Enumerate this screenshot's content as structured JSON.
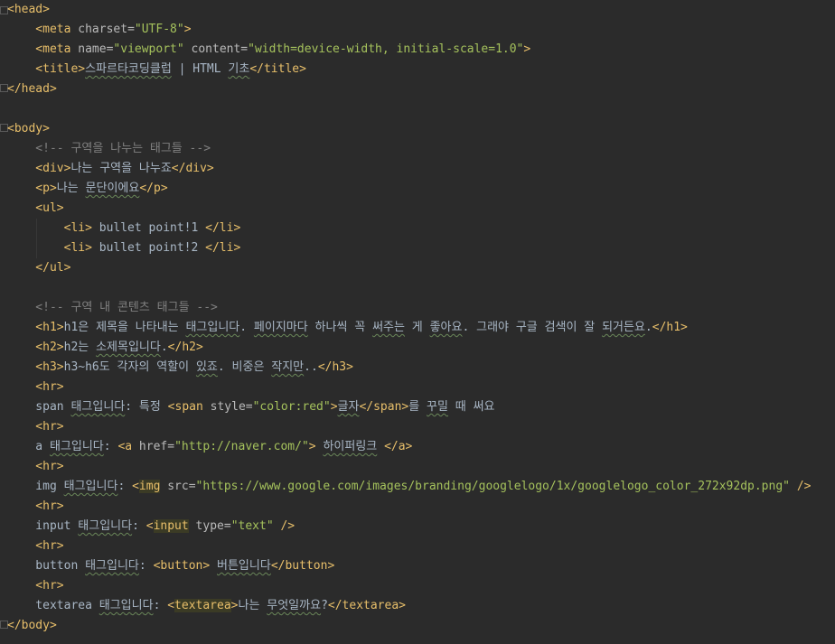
{
  "editor": {
    "lines": [
      [
        {
          "t": "tag",
          "v": "<head>"
        }
      ],
      [
        {
          "t": "tag",
          "v": "    <meta "
        },
        {
          "t": "attr",
          "v": "charset="
        },
        {
          "t": "val",
          "v": "\"UTF-8\""
        },
        {
          "t": "tag",
          "v": ">"
        }
      ],
      [
        {
          "t": "tag",
          "v": "    <meta "
        },
        {
          "t": "attr",
          "v": "name="
        },
        {
          "t": "val",
          "v": "\"viewport\" "
        },
        {
          "t": "attr",
          "v": "content="
        },
        {
          "t": "val",
          "v": "\"width=device-width, initial-scale=1.0\""
        },
        {
          "t": "tag",
          "v": ">"
        }
      ],
      [
        {
          "t": "tag",
          "v": "    <title>"
        },
        {
          "t": "sp",
          "v": "스파르타코딩클럽"
        },
        {
          "t": "txt",
          "v": " | HTML "
        },
        {
          "t": "sp",
          "v": "기초"
        },
        {
          "t": "tag",
          "v": "</title>"
        }
      ],
      [
        {
          "t": "tag",
          "v": "</head>"
        }
      ],
      [
        {
          "t": "txt",
          "v": ""
        }
      ],
      [
        {
          "t": "tag",
          "v": "<body>"
        }
      ],
      [
        {
          "t": "cm",
          "v": "    <!-- 구역을 나누는 태그들 -->"
        }
      ],
      [
        {
          "t": "tag",
          "v": "    <div>"
        },
        {
          "t": "txt",
          "v": "나는 구역을 나누죠"
        },
        {
          "t": "tag",
          "v": "</div>"
        }
      ],
      [
        {
          "t": "tag",
          "v": "    <p>"
        },
        {
          "t": "txt",
          "v": "나는 "
        },
        {
          "t": "sp",
          "v": "문단이에요"
        },
        {
          "t": "tag",
          "v": "</p>"
        }
      ],
      [
        {
          "t": "tag",
          "v": "    <ul>"
        }
      ],
      [
        {
          "t": "tag",
          "v": "        <li>"
        },
        {
          "t": "txt",
          "v": " bullet point!1 "
        },
        {
          "t": "tag",
          "v": "</li>"
        }
      ],
      [
        {
          "t": "tag",
          "v": "        <li>"
        },
        {
          "t": "txt",
          "v": " bullet point!2 "
        },
        {
          "t": "tag",
          "v": "</li>"
        }
      ],
      [
        {
          "t": "tag",
          "v": "    </ul>"
        }
      ],
      [
        {
          "t": "txt",
          "v": ""
        }
      ],
      [
        {
          "t": "cm",
          "v": "    <!-- 구역 내 콘텐츠 태그들 -->"
        }
      ],
      [
        {
          "t": "tag",
          "v": "    <h1>"
        },
        {
          "t": "txt",
          "v": "h1은 제목을 나타내는 "
        },
        {
          "t": "sp",
          "v": "태그입니다"
        },
        {
          "t": "txt",
          "v": ". "
        },
        {
          "t": "sp",
          "v": "페이지마다"
        },
        {
          "t": "txt",
          "v": " 하나씩 꼭 "
        },
        {
          "t": "sp",
          "v": "써주는"
        },
        {
          "t": "txt",
          "v": " 게 "
        },
        {
          "t": "sp",
          "v": "좋아요"
        },
        {
          "t": "txt",
          "v": ". 그래야 구글 검색이 잘 "
        },
        {
          "t": "sp",
          "v": "되거든요"
        },
        {
          "t": "txt",
          "v": "."
        },
        {
          "t": "tag",
          "v": "</h1>"
        }
      ],
      [
        {
          "t": "tag",
          "v": "    <h2>"
        },
        {
          "t": "txt",
          "v": "h2는 "
        },
        {
          "t": "sp",
          "v": "소제목입니다"
        },
        {
          "t": "txt",
          "v": "."
        },
        {
          "t": "tag",
          "v": "</h2>"
        }
      ],
      [
        {
          "t": "tag",
          "v": "    <h3>"
        },
        {
          "t": "txt",
          "v": "h3~h6도 각자의 역할이 "
        },
        {
          "t": "sp",
          "v": "있죠"
        },
        {
          "t": "txt",
          "v": ". 비중은 "
        },
        {
          "t": "sp",
          "v": "작지만"
        },
        {
          "t": "txt",
          "v": ".."
        },
        {
          "t": "tag",
          "v": "</h3>"
        }
      ],
      [
        {
          "t": "tag",
          "v": "    <hr>"
        }
      ],
      [
        {
          "t": "txt",
          "v": "    span "
        },
        {
          "t": "sp",
          "v": "태그입니다"
        },
        {
          "t": "txt",
          "v": ": 특정 "
        },
        {
          "t": "tag",
          "v": "<span "
        },
        {
          "t": "attr",
          "v": "style="
        },
        {
          "t": "val",
          "v": "\"color:red\""
        },
        {
          "t": "tag",
          "v": ">"
        },
        {
          "t": "sp",
          "v": "글자"
        },
        {
          "t": "tag",
          "v": "</span>"
        },
        {
          "t": "txt",
          "v": "를 "
        },
        {
          "t": "sp",
          "v": "꾸밀"
        },
        {
          "t": "txt",
          "v": " 때 써요"
        }
      ],
      [
        {
          "t": "tag",
          "v": "    <hr>"
        }
      ],
      [
        {
          "t": "txt",
          "v": "    a "
        },
        {
          "t": "sp",
          "v": "태그입니다"
        },
        {
          "t": "txt",
          "v": ": "
        },
        {
          "t": "tag",
          "v": "<a "
        },
        {
          "t": "attr",
          "v": "href="
        },
        {
          "t": "val",
          "v": "\"http://naver.com/\""
        },
        {
          "t": "tag",
          "v": ">"
        },
        {
          "t": "txt",
          "v": " "
        },
        {
          "t": "sp",
          "v": "하이퍼링크"
        },
        {
          "t": "txt",
          "v": " "
        },
        {
          "t": "tag",
          "v": "</a>"
        }
      ],
      [
        {
          "t": "tag",
          "v": "    <hr>"
        }
      ],
      [
        {
          "t": "txt",
          "v": "    img "
        },
        {
          "t": "sp",
          "v": "태그입니다"
        },
        {
          "t": "txt",
          "v": ": "
        },
        {
          "t": "tag",
          "v": "<"
        },
        {
          "t": "hl",
          "v": "img"
        },
        {
          "t": "tag",
          "v": " "
        },
        {
          "t": "attr",
          "v": "src="
        },
        {
          "t": "val",
          "v": "\"https://www.google.com/images/branding/googlelogo/1x/googlelogo_color_272x92dp.png\""
        },
        {
          "t": "tag",
          "v": " />"
        }
      ],
      [
        {
          "t": "tag",
          "v": "    <hr>"
        }
      ],
      [
        {
          "t": "txt",
          "v": "    input "
        },
        {
          "t": "sp",
          "v": "태그입니다"
        },
        {
          "t": "txt",
          "v": ": "
        },
        {
          "t": "tag",
          "v": "<"
        },
        {
          "t": "hl",
          "v": "input"
        },
        {
          "t": "tag",
          "v": " "
        },
        {
          "t": "attr",
          "v": "type="
        },
        {
          "t": "val",
          "v": "\"text\""
        },
        {
          "t": "tag",
          "v": " />"
        }
      ],
      [
        {
          "t": "tag",
          "v": "    <hr>"
        }
      ],
      [
        {
          "t": "txt",
          "v": "    button "
        },
        {
          "t": "sp",
          "v": "태그입니다"
        },
        {
          "t": "txt",
          "v": ": "
        },
        {
          "t": "tag",
          "v": "<button>"
        },
        {
          "t": "txt",
          "v": " "
        },
        {
          "t": "sp",
          "v": "버튼입니다"
        },
        {
          "t": "tag",
          "v": "</button>"
        }
      ],
      [
        {
          "t": "tag",
          "v": "    <hr>"
        }
      ],
      [
        {
          "t": "txt",
          "v": "    textarea "
        },
        {
          "t": "sp",
          "v": "태그입니다"
        },
        {
          "t": "txt",
          "v": ": "
        },
        {
          "t": "tag",
          "v": "<"
        },
        {
          "t": "hl",
          "v": "textarea"
        },
        {
          "t": "tag",
          "v": ">"
        },
        {
          "t": "txt",
          "v": "나는 "
        },
        {
          "t": "sp",
          "v": "무엇일까요"
        },
        {
          "t": "txt",
          "v": "?"
        },
        {
          "t": "tag",
          "v": "</textarea>"
        }
      ],
      [
        {
          "t": "tag",
          "v": "</body>"
        }
      ]
    ]
  }
}
